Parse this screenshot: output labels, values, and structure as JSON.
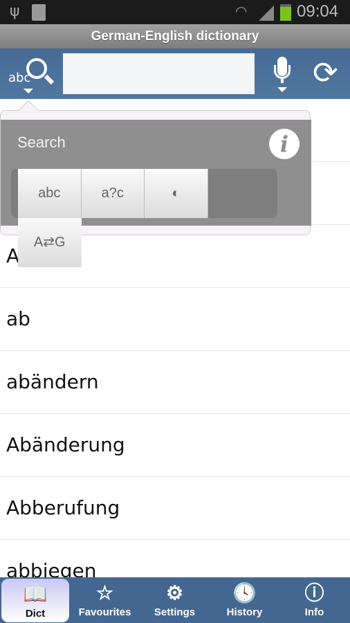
{
  "status_bar": {
    "time": "09:04",
    "icons": [
      "usb-icon",
      "sd-card-icon",
      "wifi-icon",
      "signal-icon",
      "battery-charging-icon"
    ]
  },
  "app_title": "German-English dictionary",
  "toolbar": {
    "search_input_value": "",
    "search_mode_label": "abc",
    "icons": [
      "search-mode-icon",
      "microphone-icon",
      "refresh-icon"
    ]
  },
  "popup": {
    "title": "Search",
    "modes": [
      {
        "name": "full-text-search",
        "glyph": "abc"
      },
      {
        "name": "wildcard-search",
        "glyph": "a?c"
      },
      {
        "name": "fuzzy-search",
        "glyph": "◐"
      },
      {
        "name": "translation-direction",
        "glyph": "A⇄G"
      }
    ]
  },
  "list": {
    "items": [
      "",
      "",
      "Aas",
      "ab",
      "abändern",
      "Abänderung",
      "Abberufung",
      "abbiegen"
    ]
  },
  "nav": {
    "items": [
      {
        "label": "Dict",
        "icon": "📖",
        "active": true
      },
      {
        "label": "Favourites",
        "icon": "☆"
      },
      {
        "label": "Settings",
        "icon": "⚙"
      },
      {
        "label": "History",
        "icon": "🕓"
      },
      {
        "label": "Info",
        "icon": "ⓘ"
      }
    ]
  },
  "colors": {
    "toolbar": "#4a6d97",
    "nav": "#436790",
    "popup": "#8f8f8f",
    "battery": "#7cc21a"
  }
}
